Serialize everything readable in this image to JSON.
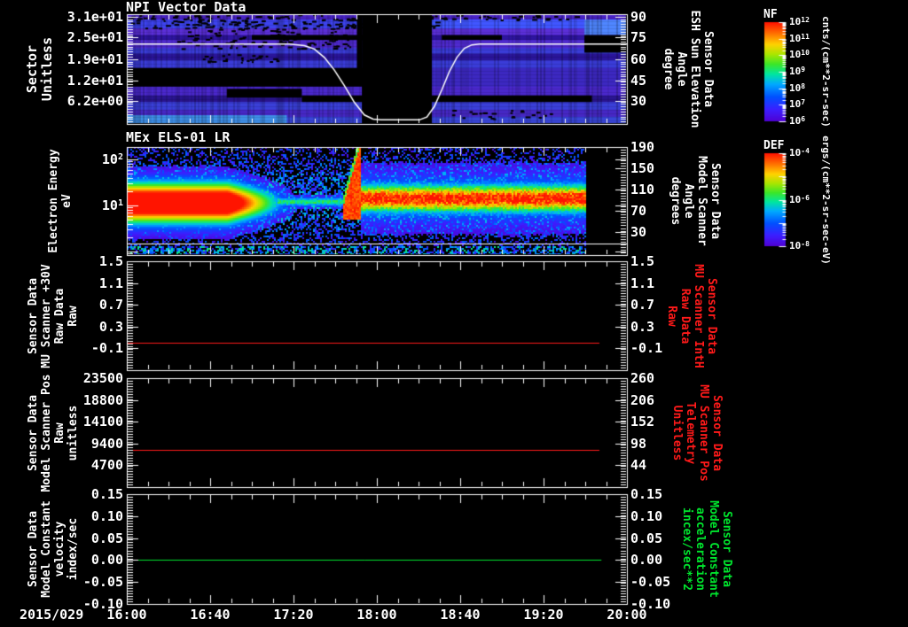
{
  "x_axis": {
    "date": "2015/029",
    "ticks": [
      "16:00",
      "16:40",
      "17:20",
      "18:00",
      "18:40",
      "19:20",
      "20:00"
    ]
  },
  "colors": {
    "background": "#000000",
    "foreground": "#ffffff",
    "red_series": "#ff1a1a",
    "green_series": "#00e52e",
    "overlay_line": "#ffffff"
  },
  "panels": [
    {
      "title": "NPI Vector Data",
      "left_title_lines": [
        "Sector",
        "Unitless"
      ],
      "left_ticks": [
        {
          "t": "3.1e+01",
          "f": 0.024
        },
        {
          "t": "2.5e+01",
          "f": 0.21
        },
        {
          "t": "1.9e+01",
          "f": 0.41
        },
        {
          "t": "1.2e+01",
          "f": 0.605
        },
        {
          "t": "6.2e+00",
          "f": 0.79
        }
      ],
      "right_title_lines": [
        "Sensor Data",
        "ESH Sun Elevation",
        "Angle",
        "degree"
      ],
      "right_title_color": "#ffffff",
      "right_ticks": [
        {
          "t": "90",
          "f": 0.024
        },
        {
          "t": "75",
          "f": 0.21
        },
        {
          "t": "60",
          "f": 0.41
        },
        {
          "t": "45",
          "f": 0.605
        },
        {
          "t": "30",
          "f": 0.79
        }
      ]
    },
    {
      "title": "MEx ELS-01 LR",
      "left_title_lines": [
        "Electron Energy",
        "eV"
      ],
      "left_ticks": [
        {
          "b": "10",
          "e": "2",
          "f": 0.115
        },
        {
          "b": "10",
          "e": "1",
          "f": 0.541
        }
      ],
      "right_title_lines": [
        "Sensor Data",
        "Model Scanner",
        "Angle",
        "degrees"
      ],
      "right_title_color": "#ffffff",
      "right_ticks": [
        {
          "t": "190",
          "f": 0.0
        },
        {
          "t": "150",
          "f": 0.197
        },
        {
          "t": "110",
          "f": 0.394
        },
        {
          "t": "70",
          "f": 0.591
        },
        {
          "t": "30",
          "f": 0.787
        }
      ]
    },
    {
      "left_title_lines": [
        "Sensor Data",
        "MU Scanner +30V",
        "Raw Data",
        "Raw"
      ],
      "left_ticks": [
        {
          "t": "1.5",
          "f": 0.0
        },
        {
          "t": "1.1",
          "f": 0.2
        },
        {
          "t": "0.7",
          "f": 0.4
        },
        {
          "t": "0.3",
          "f": 0.6
        },
        {
          "t": "-0.1",
          "f": 0.8
        }
      ],
      "right_title_lines": [
        "Sensor Data",
        "MU Scanner IntH",
        "Raw Data",
        "Raw"
      ],
      "right_title_color": "#ff1a1a",
      "right_ticks": [
        {
          "t": "1.5",
          "f": 0.0
        },
        {
          "t": "1.1",
          "f": 0.2
        },
        {
          "t": "0.7",
          "f": 0.4
        },
        {
          "t": "0.3",
          "f": 0.6
        },
        {
          "t": "-0.1",
          "f": 0.8
        }
      ]
    },
    {
      "left_title_lines": [
        "Sensor Data",
        "Model Scanner Pos",
        "Raw",
        "unitless"
      ],
      "left_ticks": [
        {
          "t": "23500",
          "f": 0.0
        },
        {
          "t": "18800",
          "f": 0.2
        },
        {
          "t": "14100",
          "f": 0.4
        },
        {
          "t": "9400",
          "f": 0.6
        },
        {
          "t": "4700",
          "f": 0.8
        }
      ],
      "right_title_lines": [
        "Sensor Data",
        "MU Scanner Pos",
        "Telemetry",
        "Unitless"
      ],
      "right_title_color": "#ff1a1a",
      "right_ticks": [
        {
          "t": "260",
          "f": 0.0
        },
        {
          "t": "206",
          "f": 0.2
        },
        {
          "t": "152",
          "f": 0.4
        },
        {
          "t": "98",
          "f": 0.6
        },
        {
          "t": "44",
          "f": 0.8
        }
      ]
    },
    {
      "left_title_lines": [
        "Sensor Data",
        "Model Constant",
        "velocity",
        "index/sec"
      ],
      "left_ticks": [
        {
          "t": "0.15",
          "f": 0.0
        },
        {
          "t": "0.10",
          "f": 0.2
        },
        {
          "t": "0.05",
          "f": 0.4
        },
        {
          "t": "0.00",
          "f": 0.6
        },
        {
          "t": "-0.05",
          "f": 0.8
        },
        {
          "t": "-0.10",
          "f": 1.0
        }
      ],
      "right_title_lines": [
        "Sensor Data",
        "Model Constant",
        "acceleration",
        "incex/sec**2"
      ],
      "right_title_color": "#00e52e",
      "right_ticks": [
        {
          "t": "0.15",
          "f": 0.0
        },
        {
          "t": "0.10",
          "f": 0.2
        },
        {
          "t": "0.05",
          "f": 0.4
        },
        {
          "t": "0.00",
          "f": 0.6
        },
        {
          "t": "-0.05",
          "f": 0.8
        },
        {
          "t": "-0.10",
          "f": 1.0
        }
      ]
    }
  ],
  "colorbars": [
    {
      "title": "NF",
      "units": "cnts/(cm**2-sr-sec)",
      "ticks": [
        {
          "b": "10",
          "e": "12",
          "f": 0
        },
        {
          "b": "10",
          "e": "11",
          "f": 0.1667
        },
        {
          "b": "10",
          "e": "10",
          "f": 0.3333
        },
        {
          "b": "10",
          "e": "9",
          "f": 0.5
        },
        {
          "b": "10",
          "e": "8",
          "f": 0.6667
        },
        {
          "b": "10",
          "e": "7",
          "f": 0.8333
        },
        {
          "b": "10",
          "e": "6",
          "f": 1
        }
      ]
    },
    {
      "title": "DEF",
      "units": "ergs/(cm**2-sr-sec-eV)",
      "ticks": [
        {
          "b": "10",
          "e": "-4",
          "f": 0
        },
        {
          "b": "10",
          "e": "-6",
          "f": 0.5
        },
        {
          "b": "10",
          "e": "-8",
          "f": 1
        }
      ]
    }
  ],
  "chart_data": [
    {
      "type": "heatmap",
      "panel": 1,
      "title": "NPI Vector Data",
      "ylabel": "Sector Unitless",
      "ylim": [
        0,
        32
      ],
      "xlim": [
        "2015/029 16:00",
        "2015/029 20:00"
      ],
      "colorbar": {
        "name": "NF",
        "units": "cnts/(cm**2-sr-sec)",
        "range_exponents": [
          6,
          12
        ]
      },
      "data_gap": {
        "x_start": "17:51",
        "x_end": "18:26"
      },
      "overlay_line": {
        "name": "ESH Sun Elevation Angle",
        "units": "degree",
        "color": "#ffffff",
        "points_time_deg": [
          [
            16.0,
            70.5
          ],
          [
            17.3,
            70.5
          ],
          [
            17.42,
            69.5
          ],
          [
            17.5,
            67
          ],
          [
            17.58,
            61
          ],
          [
            17.66,
            52
          ],
          [
            17.74,
            41
          ],
          [
            17.82,
            29
          ],
          [
            17.9,
            20
          ],
          [
            17.97,
            17
          ],
          [
            18.03,
            16.5
          ],
          [
            18.34,
            16.5
          ],
          [
            18.4,
            18.5
          ],
          [
            18.46,
            26
          ],
          [
            18.52,
            38
          ],
          [
            18.58,
            51
          ],
          [
            18.64,
            61
          ],
          [
            18.7,
            67.5
          ],
          [
            18.76,
            70
          ],
          [
            18.82,
            70.5
          ],
          [
            20.0,
            70.5
          ]
        ]
      },
      "stripes": [
        {
          "f0": 0.0,
          "f1": 0.05,
          "c": "#4a23c8"
        },
        {
          "f0": 0.05,
          "f1": 0.13,
          "c": "#3d43ee"
        },
        {
          "f0": 0.13,
          "f1": 0.19,
          "c": "#5b2fd8"
        },
        {
          "f0": 0.19,
          "f1": 0.235,
          "c": "#2e14a0"
        },
        {
          "f0": 0.235,
          "f1": 0.31,
          "c": "#4f2ad0"
        },
        {
          "f0": 0.31,
          "f1": 0.36,
          "c": "#3a3cd8"
        },
        {
          "f0": 0.36,
          "f1": 0.42,
          "c": "#2a159a"
        },
        {
          "f0": 0.42,
          "f1": 0.49,
          "c": "#3a3cd8"
        },
        {
          "f0": 0.49,
          "f1": 0.66,
          "c": "#3c28c0"
        },
        {
          "f0": 0.66,
          "f1": 0.74,
          "c": "#4a28cc"
        },
        {
          "f0": 0.74,
          "f1": 0.8,
          "c": "#2a1590"
        },
        {
          "f0": 0.8,
          "f1": 0.87,
          "c": "#3a3fd8"
        },
        {
          "f0": 0.87,
          "f1": 0.935,
          "c": "#4628c4"
        },
        {
          "f0": 0.935,
          "f1": 1.0,
          "c": "#3946d8"
        }
      ],
      "bright_patches": [
        {
          "x0": 0.915,
          "x1": 1.0,
          "f0": 0.05,
          "f1": 0.19,
          "c": "#4f86ff"
        },
        {
          "x0": 0.61,
          "x1": 0.915,
          "f0": 0.05,
          "f1": 0.13,
          "c": "#4056ff"
        },
        {
          "x0": 0.0,
          "x1": 0.32,
          "f0": 0.92,
          "f1": 1.0,
          "c": "#3f8fe8"
        }
      ],
      "black_patches": [
        {
          "x0": 0.47,
          "x1": 0.61,
          "f0": 0.0,
          "f1": 1.0
        },
        {
          "x0": 0.46,
          "x1": 0.47,
          "f0": 0.0,
          "f1": 0.55
        },
        {
          "x0": 0.0,
          "x1": 0.58,
          "f0": 0.49,
          "f1": 0.66
        },
        {
          "x0": 0.2,
          "x1": 0.35,
          "f0": 0.68,
          "f1": 0.76
        },
        {
          "x0": 0.35,
          "x1": 0.93,
          "f0": 0.74,
          "f1": 0.8
        },
        {
          "x0": 0.25,
          "x1": 0.52,
          "f0": 0.19,
          "f1": 0.235
        },
        {
          "x0": 0.63,
          "x1": 0.75,
          "f0": 0.19,
          "f1": 0.235
        },
        {
          "x0": 0.915,
          "x1": 1.0,
          "f0": 0.19,
          "f1": 0.35
        }
      ],
      "speckle": [
        {
          "x0": 0.0,
          "x1": 0.62,
          "f0": 0.0,
          "f1": 0.13,
          "d": 0.35
        },
        {
          "x0": 0.1,
          "x1": 0.45,
          "f0": 0.13,
          "f1": 0.31,
          "d": 0.25
        },
        {
          "x0": 0.15,
          "x1": 0.3,
          "f0": 0.36,
          "f1": 0.44,
          "d": 0.3
        },
        {
          "x0": 0.62,
          "x1": 0.9,
          "f0": 0.0,
          "f1": 0.05,
          "d": 0.3
        },
        {
          "x0": 0.65,
          "x1": 0.85,
          "f0": 0.87,
          "f1": 0.95,
          "d": 0.2
        }
      ]
    },
    {
      "type": "heatmap",
      "panel": 2,
      "title": "MEx ELS-01 LR",
      "ylabel": "Electron Energy (eV)",
      "yscale": "log",
      "ylim": [
        1,
        190
      ],
      "colorbar": {
        "name": "DEF",
        "units": "ergs/(cm**2-sr-sec-eV)",
        "range_exponents": [
          -8,
          -4
        ]
      },
      "features": {
        "intense_blob": {
          "t_start": 16.0,
          "t_end": 17.35,
          "energy_center_eV": 18
        },
        "sparse_interval": {
          "t_start": 17.35,
          "t_end": 17.73
        },
        "flare_to_top": {
          "t_start": 17.73,
          "t_end": 17.87
        },
        "steady_band": {
          "t_start": 17.87,
          "t_end": 19.67,
          "energy_center_eV": 16
        },
        "data_end_time": 19.67,
        "white_line_energy_eV": 1.5
      },
      "paint": {
        "blob": {
          "x0": 0.0,
          "x1": 0.34,
          "x_core": 0.2,
          "yc": 0.51,
          "sig": 0.13
        },
        "thin_band": {
          "x0": 0.3,
          "x1": 0.432,
          "yc": 0.5,
          "sig": 0.03
        },
        "flame": {
          "x0": 0.432,
          "x1": 0.468,
          "y_base": 0.52,
          "rise": 0.6
        },
        "band": {
          "x0": 0.468,
          "x1": 0.917,
          "yc": 0.47,
          "sig": 0.075
        },
        "data_end_x": 0.917,
        "white_line_f": 0.893,
        "strip_f": 0.905
      }
    },
    {
      "type": "line",
      "panel": 3,
      "ylim_left": [
        -0.5,
        1.5
      ],
      "ylim_right": [
        -0.5,
        1.5
      ],
      "series": [
        {
          "name": "MU Scanner +30V Raw Data Raw",
          "color": "#ff1a1a",
          "constant_value": 0.0,
          "t_start": 16.0,
          "t_end": 19.78,
          "value_frac": 0.75,
          "x_end_frac": 0.945
        }
      ]
    },
    {
      "type": "line",
      "panel": 4,
      "ylim_left": [
        0,
        23500
      ],
      "ylim_right": [
        -10,
        260
      ],
      "series": [
        {
          "name": "Model Scanner Pos Raw unitless",
          "color": "#ff1a1a",
          "constant_value": 8100,
          "t_start": 16.0,
          "t_end": 19.78,
          "value_frac": 0.655,
          "x_end_frac": 0.945
        }
      ]
    },
    {
      "type": "line",
      "panel": 5,
      "ylim_left": [
        -0.1,
        0.15
      ],
      "ylim_right": [
        -0.1,
        0.15
      ],
      "series": [
        {
          "name": "Model Constant velocity index/sec",
          "color": "#00e52e",
          "constant_value": 0.0,
          "t_start": 16.0,
          "t_end": 19.8,
          "value_frac": 0.6,
          "x_end_frac": 0.949
        }
      ]
    }
  ]
}
